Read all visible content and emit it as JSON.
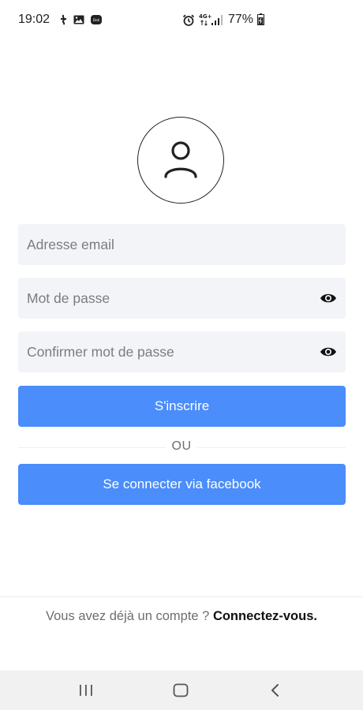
{
  "status_bar": {
    "time": "19:02",
    "network": "4G+",
    "battery": "77%"
  },
  "form": {
    "email_placeholder": "Adresse email",
    "password_placeholder": "Mot de passe",
    "confirm_placeholder": "Confirmer mot de passe",
    "signup_label": "S'inscrire",
    "or_label": "OU",
    "facebook_label": "Se connecter via facebook"
  },
  "footer": {
    "prompt": "Vous avez déjà un compte ?",
    "link": "Connectez-vous."
  },
  "colors": {
    "primary": "#4a8dfb",
    "field_bg": "#f3f4f8"
  },
  "icons": {
    "avatar": "user-icon",
    "eye": "eye-icon",
    "nav_recent": "recent-apps-icon",
    "nav_home": "home-icon",
    "nav_back": "back-icon"
  }
}
